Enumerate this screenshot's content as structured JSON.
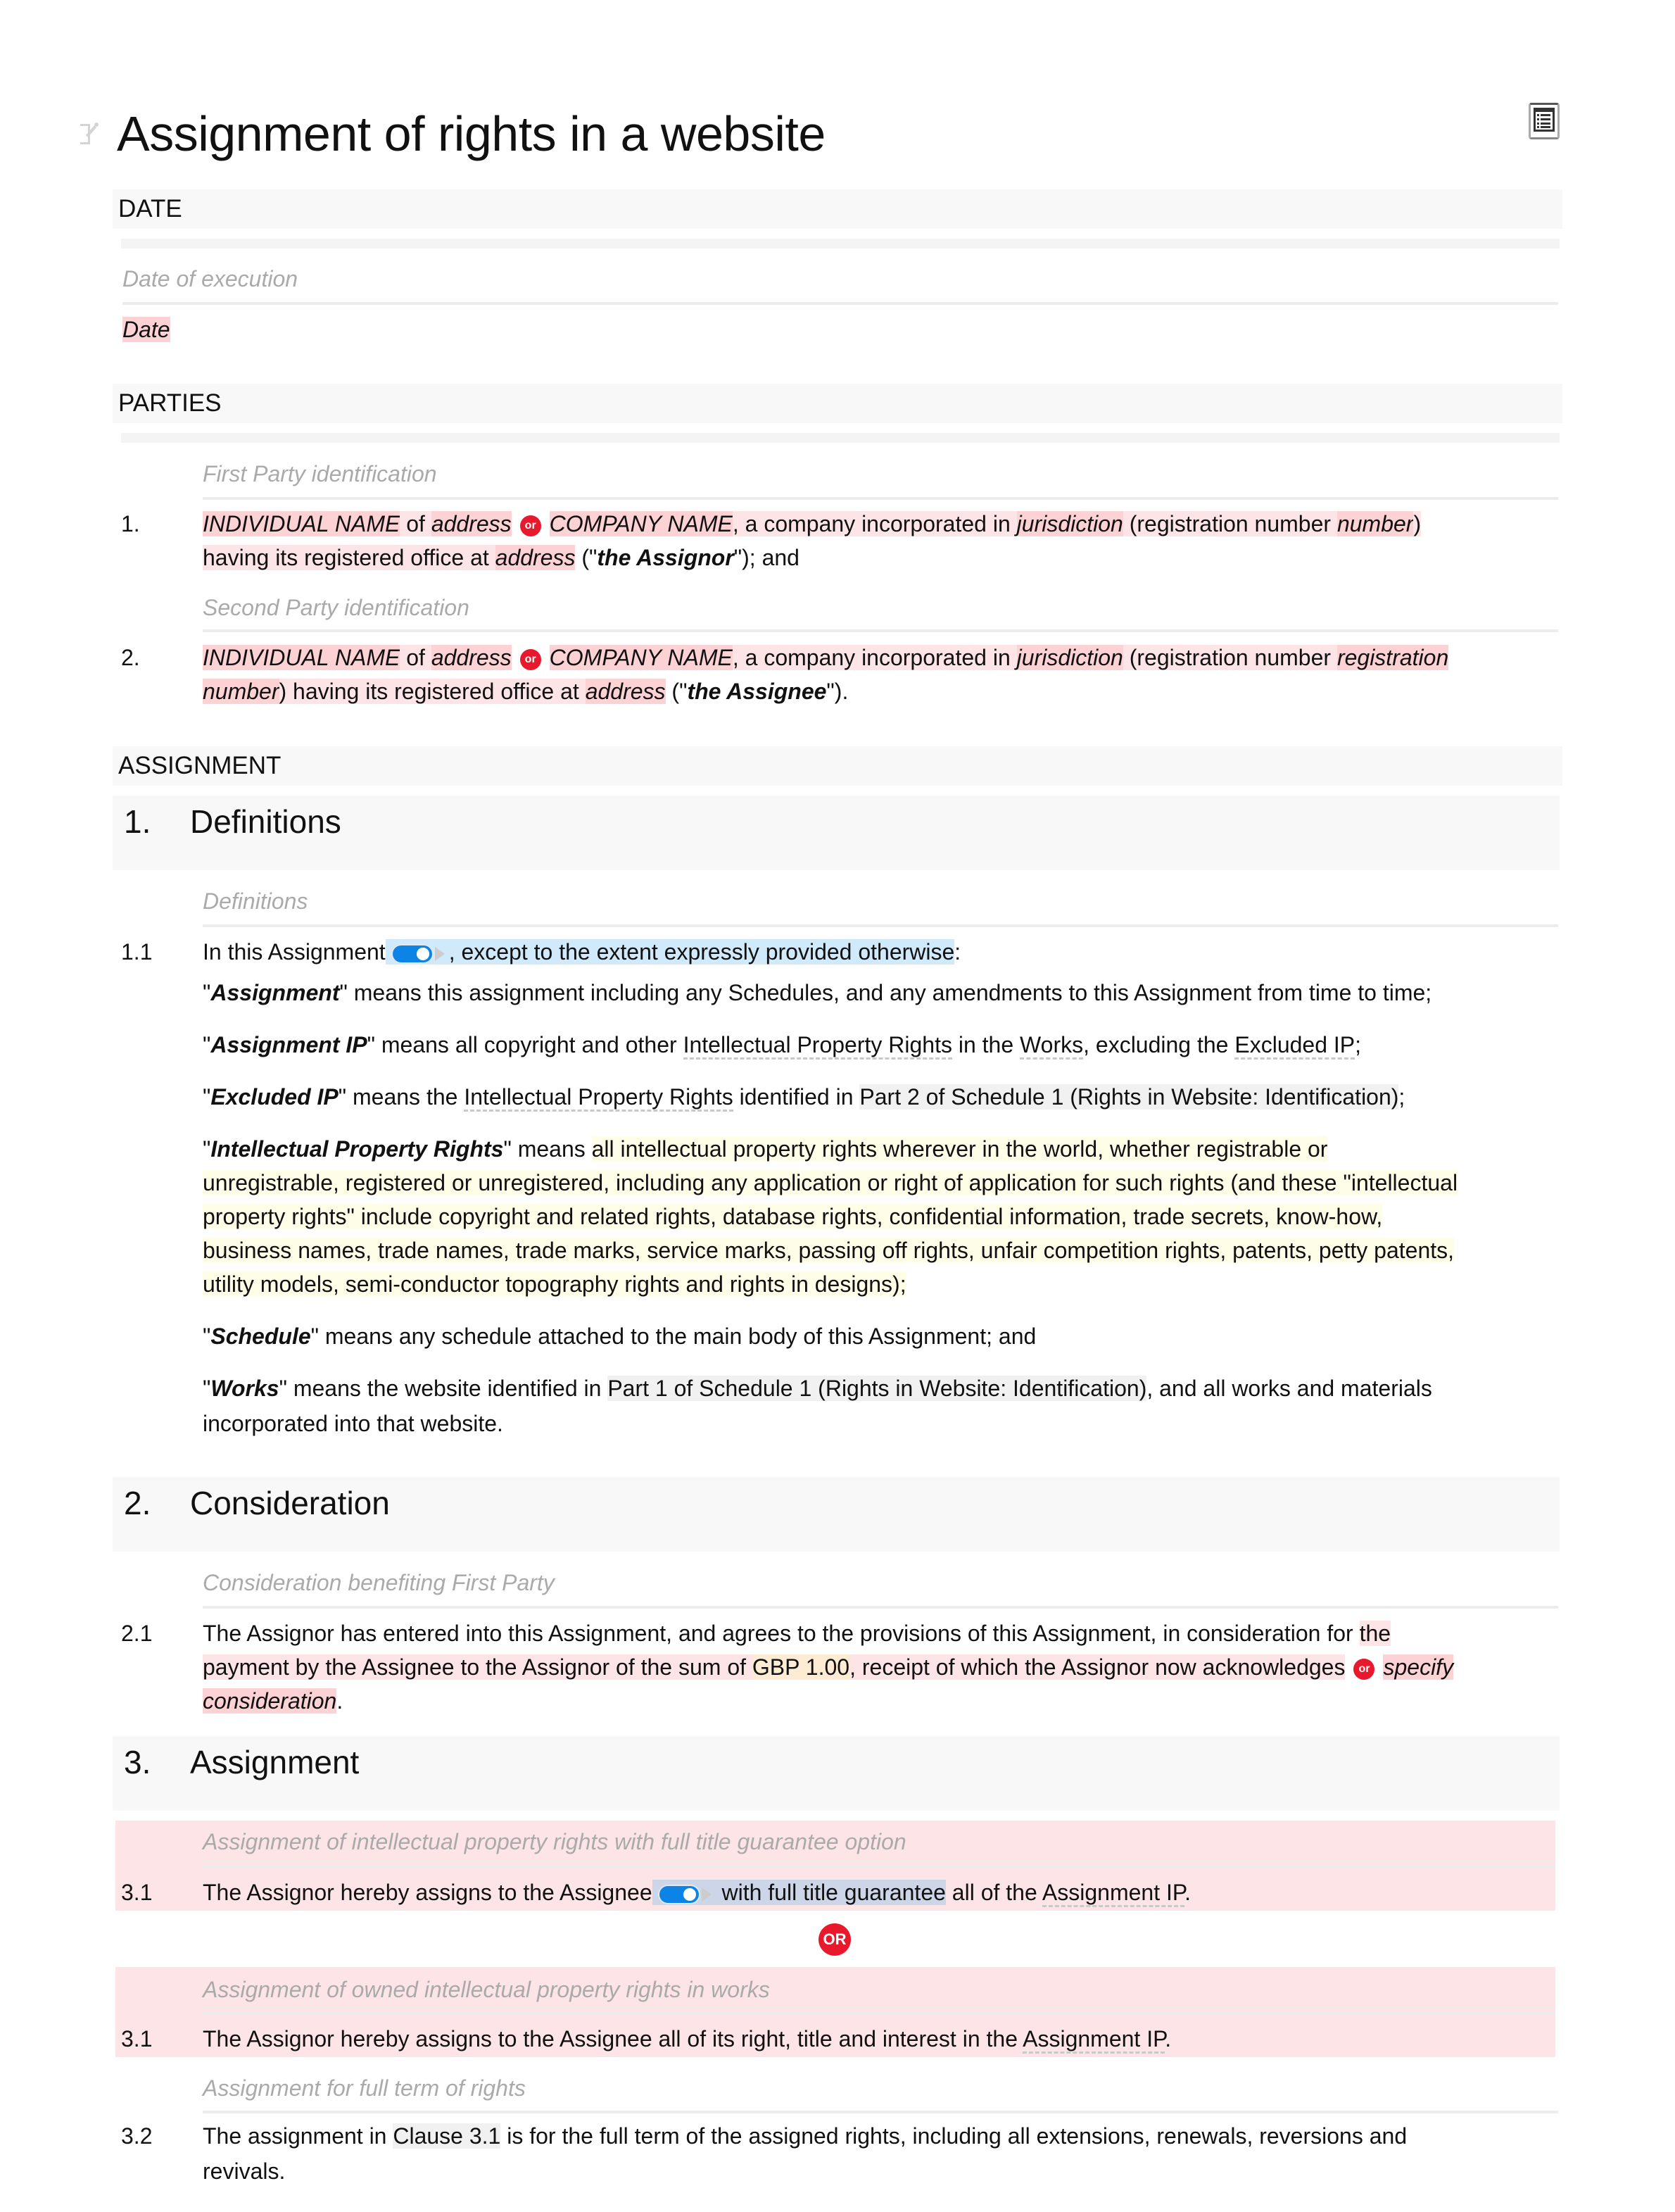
{
  "document": {
    "title": "Assignment of rights in a website",
    "toc_button": "table-of-contents",
    "edit_icon": "pencil-icon"
  },
  "date_section": {
    "heading": "DATE",
    "note": "Date of execution",
    "placeholder": "Date"
  },
  "parties_section": {
    "heading": "PARTIES",
    "party1": {
      "note": "First Party identification",
      "number": "1.",
      "individual_name": "INDIVIDUAL NAME",
      "of": " of ",
      "address1": "address",
      "or": "or",
      "company_name": "COMPANY NAME",
      "text1": ", a company incorporated in ",
      "jurisdiction": "jurisdiction",
      "text2": " (registration number ",
      "reg_number": "number",
      "text3": ")",
      "text4": "having its registered office at ",
      "address2": "address",
      "text5": " (\"",
      "defined": "the Assignor",
      "text6": "\"); and"
    },
    "party2": {
      "note": "Second Party identification",
      "number": "2.",
      "individual_name": "INDIVIDUAL NAME",
      "of": " of ",
      "address1": "address",
      "or": "or",
      "company_name": "COMPANY NAME",
      "text1": ", a company incorporated in ",
      "jurisdiction": "jurisdiction",
      "text2": " (registration number ",
      "reg_number_a": "registration",
      "reg_number_b": "number",
      "text3": ") having its registered office at ",
      "address2": "address",
      "text5": " (\"",
      "defined": "the Assignee",
      "text6": "\")."
    }
  },
  "assignment_section": {
    "heading": "ASSIGNMENT",
    "clauses": [
      {
        "number": "1.",
        "title": "Definitions",
        "note": "Definitions",
        "c11_num": "1.1",
        "c11_text_a": "In this Assignment",
        "c11_text_b": ", except to the extent expressly provided otherwise",
        "c11_text_c": ":",
        "toggle_on": true,
        "defs": {
          "assignment_term": "Assignment",
          "assignment_text": "\" means this assignment including any Schedules, and any amendments to this Assignment from time to time;",
          "aip_term": "Assignment IP",
          "aip_t1": "\" means all copyright and other ",
          "aip_link1": "Intellectual Property Rights",
          "aip_t2": " in the ",
          "aip_link2": "Works",
          "aip_t3": ", excluding the ",
          "aip_link3": "Excluded IP",
          "aip_t4": ";",
          "eip_term": "Excluded IP",
          "eip_t1": "\" means the ",
          "eip_link1": "Intellectual Property Rights",
          "eip_t2": " identified in ",
          "eip_ref": "Part 2 of Schedule 1 (Rights in Website: Identification)",
          "eip_t3": ";",
          "ipr_term": "Intellectual Property Rights",
          "ipr_t1": "\" means ",
          "ipr_l1": "all intellectual property rights wherever in the world, whether registrable or",
          "ipr_l2": "unregistrable, registered or unregistered, including any application or right of application for such rights (and these \"intellectual",
          "ipr_l3": "property rights\" include copyright and related rights, database rights, confidential information, trade secrets, know-how,",
          "ipr_l4": "business names, trade names, trade marks, service marks, passing off rights, unfair competition rights, patents, petty patents,",
          "ipr_l5": "utility models, semi-conductor topography rights and rights in designs);",
          "sch_term": "Schedule",
          "sch_text": "\" means any schedule attached to the main body of this Assignment; and",
          "works_term": "Works",
          "works_t1": "\" means the website identified in ",
          "works_ref": "Part 1 of Schedule 1 (Rights in Website: Identification)",
          "works_t2": ", and all works and materials",
          "works_l2": "incorporated into that website."
        }
      },
      {
        "number": "2.",
        "title": "Consideration",
        "note": "Consideration benefiting First Party",
        "c21_num": "2.1",
        "c21_t1": "The Assignor has entered into this Assignment, and agrees to the provisions of this Assignment, in consideration for ",
        "c21_opt_a1": "the",
        "c21_opt_a2": "payment by the Assignee to the Assignor of the sum of ",
        "c21_amount": "GBP 1.00",
        "c21_opt_a3": ", receipt of which the Assignor now acknowledges",
        "or": "or",
        "c21_opt_b1": "specify",
        "c21_opt_b2": "consideration",
        "c21_end": "."
      },
      {
        "number": "3.",
        "title": "Assignment",
        "option1": {
          "note": "Assignment of intellectual property rights with full title guarantee option",
          "num": "3.1",
          "t1": "The Assignor hereby assigns to the Assignee",
          "toggle_on": true,
          "opt": " with full title guarantee",
          "t2": " all of the ",
          "link": "Assignment IP",
          "t3": "."
        },
        "or_label": "OR",
        "option2": {
          "note": "Assignment of owned intellectual property rights in works",
          "num": "3.1",
          "t1": "The Assignor hereby assigns to the Assignee all of its right, title and interest in the ",
          "link": "Assignment IP",
          "t2": "."
        },
        "c32": {
          "note": "Assignment for full term of rights",
          "num": "3.2",
          "t1": "The assignment in ",
          "ref": "Clause 3.1",
          "t2": " is for the full term of the assigned rights, including all extensions, renewals, reversions and",
          "l2": "revivals."
        }
      }
    ]
  },
  "colors": {
    "placeholder_bg": "#fdd2d4",
    "option_bg": "#fde5e7",
    "or_badge": "#e8192c",
    "toggle": "#0b84e6",
    "highlight_blue": "#d0e9fb",
    "definition_bg": "#fefde8"
  }
}
